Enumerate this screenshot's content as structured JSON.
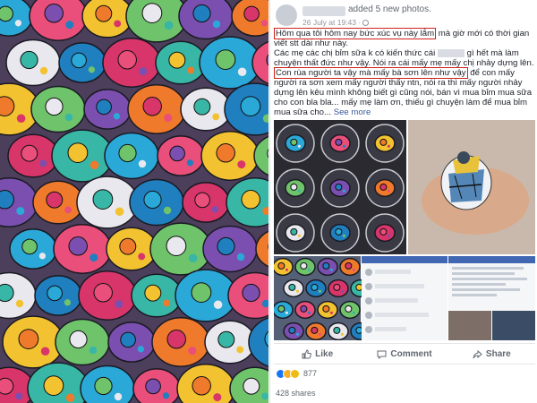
{
  "post": {
    "action_text": "added 5 new photos.",
    "time": "26 July at 19:43 ·",
    "line1_highlight": "Hôm qua tôi hôm nay bức xúc vụ này lắm",
    "line1_rest": " mà giờ mới có thời gian viết stt dài như này.",
    "line2": "Các mẹ các chị bỉm sữa k có kiến thức cái",
    "line2_rest": " gì hết mà làm chuyện thất đức như vậy. Nói ra cái mấy mẹ mấy chị nhảy dựng lên.",
    "line3_highlight": "Con rùa người ta vậy mà mấy bà sơn lên như vậy",
    "line3_rest": " để con mấy người ra sơn xem mấy người thấy ntn, nói ra thì mấy người nhảy dựng lên kêu mình không biết gì cũng nói, bán vì mua bỉm mua sữa cho con bla bla... mấy mẹ làm ơn, thiếu gì chuyện làm để mua bỉm mua sữa cho...",
    "see_more": "See more"
  },
  "actions": {
    "like": "Like",
    "comment": "Comment",
    "share": "Share"
  },
  "reactions": {
    "count": "877"
  },
  "shares": "428 shares",
  "colors": {
    "highlight_box": "#d0211c",
    "fb_blue": "#385898",
    "text": "#1d2129",
    "muted": "#90949c"
  }
}
